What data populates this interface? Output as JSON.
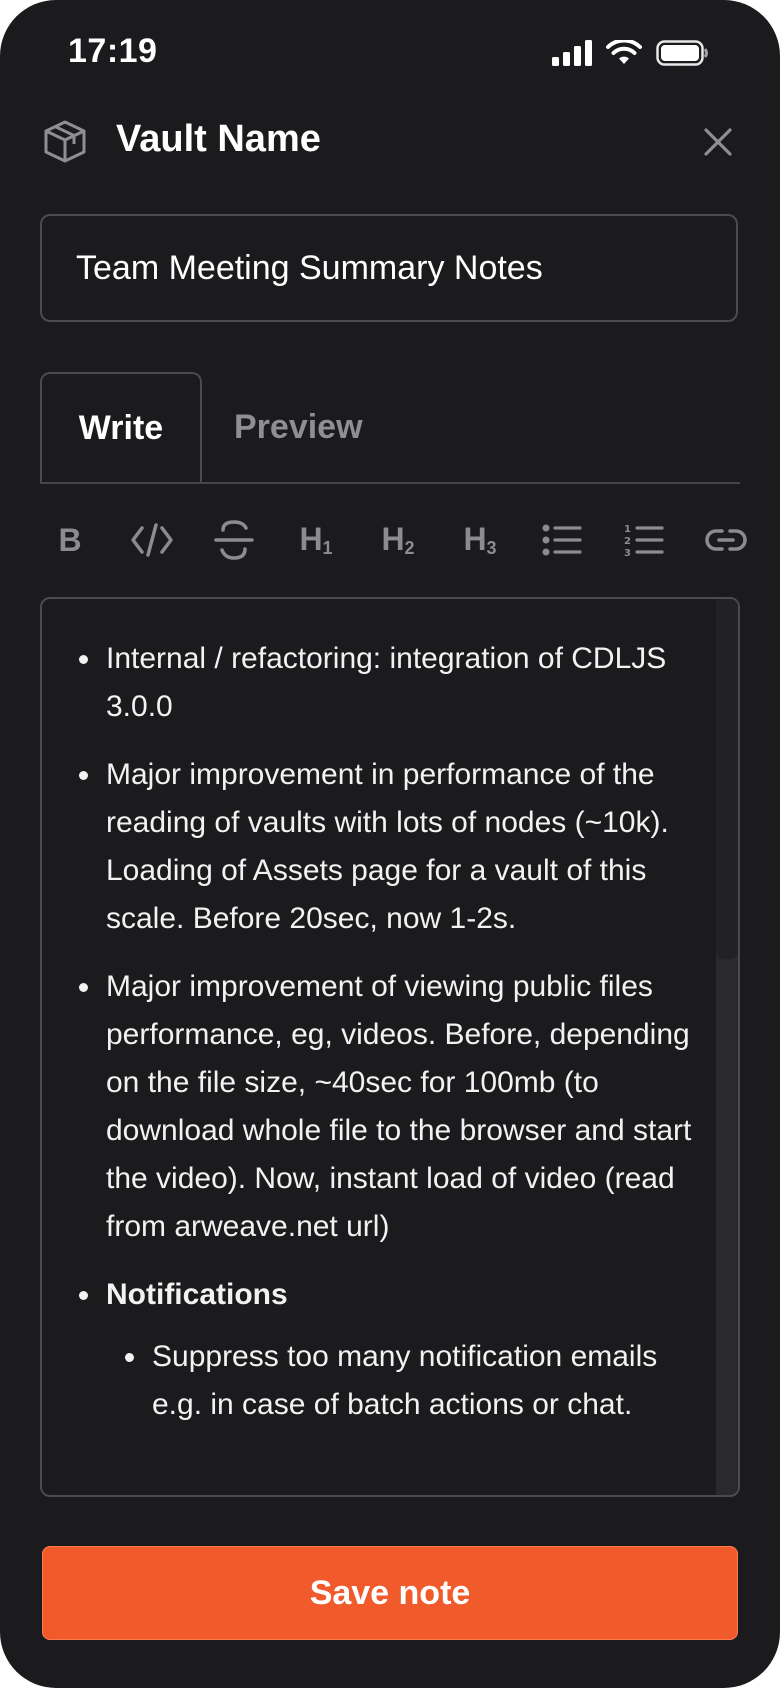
{
  "status_bar": {
    "time": "17:19"
  },
  "header": {
    "title": "Vault Name"
  },
  "note": {
    "title_value": "Team Meeting Summary Notes"
  },
  "tabs": {
    "write": "Write",
    "preview": "Preview"
  },
  "toolbar": {
    "bold": "B",
    "h1": "H",
    "h1_sub": "1",
    "h2": "H",
    "h2_sub": "2",
    "h3": "H",
    "h3_sub": "3"
  },
  "editor": {
    "items": [
      "Internal / refactoring: integration of CDLJS 3.0.0",
      "Major improvement in performance of the reading of vaults with lots of nodes (~10k). Loading of Assets page for a vault of this scale. Before 20sec, now 1-2s.",
      "Major improvement of viewing public files performance, eg, videos. Before, depending on the file size, ~40sec for 100mb (to download whole file to the browser and start the video). Now, instant load of video (read from arweave.net url)",
      "Notifications"
    ],
    "sub_items": [
      "Suppress too many notification emails e.g. in case of batch actions or chat."
    ]
  },
  "actions": {
    "save": "Save note"
  },
  "colors": {
    "background": "#1b1b1d",
    "accent": "#f15a2b",
    "border": "#4a4a4f",
    "muted": "#8e8e93"
  }
}
